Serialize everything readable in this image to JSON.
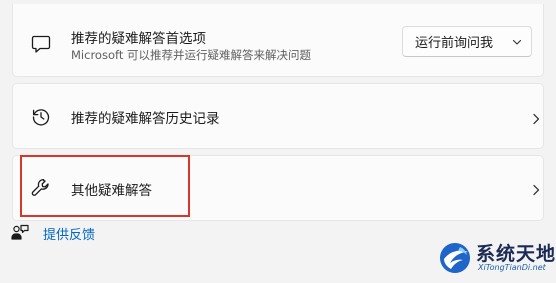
{
  "cards": [
    {
      "icon": "chat-bubble-icon",
      "title": "推荐的疑难解答首选项",
      "subtitle": "Microsoft 可以推荐并运行疑难解答来解决问题",
      "dropdown": {
        "selected": "运行前询问我",
        "icon": "chevron-down-icon"
      }
    },
    {
      "icon": "history-icon",
      "title": "推荐的疑难解答历史记录",
      "chevron": "chevron-right-icon"
    },
    {
      "icon": "wrench-icon",
      "title": "其他疑难解答",
      "chevron": "chevron-right-icon",
      "highlighted": true
    }
  ],
  "feedback": {
    "icon": "feedback-person-icon",
    "label": "提供反馈"
  },
  "watermark": {
    "text": "系统天地",
    "url": "XiTongTianDi.net"
  },
  "colors": {
    "background": "#f3f3f3",
    "card": "#fbfbfb",
    "link": "#0067c0",
    "highlight_border": "#d9362b"
  }
}
